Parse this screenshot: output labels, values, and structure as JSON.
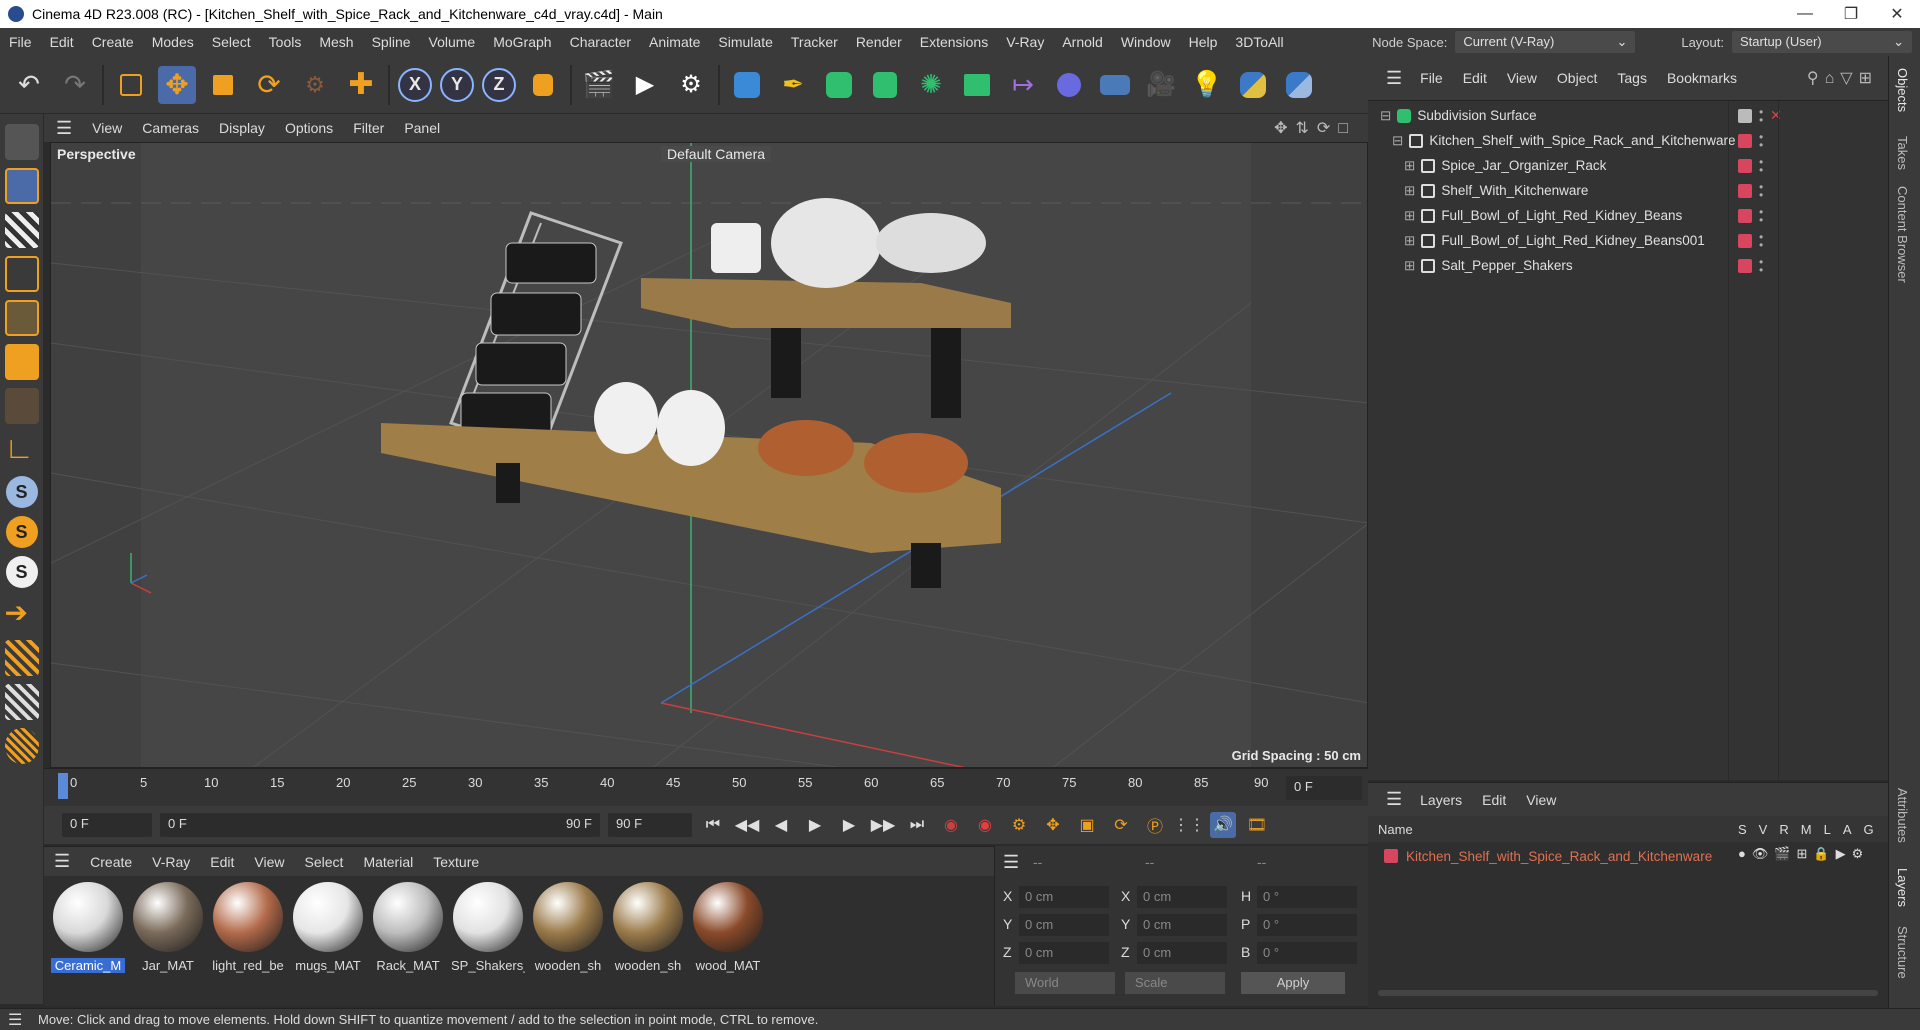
{
  "window": {
    "title": "Cinema 4D R23.008 (RC) - [Kitchen_Shelf_with_Spice_Rack_and_Kitchenware_c4d_vray.c4d] - Main"
  },
  "menubar": {
    "items": [
      "File",
      "Edit",
      "Create",
      "Modes",
      "Select",
      "Tools",
      "Mesh",
      "Spline",
      "Volume",
      "MoGraph",
      "Character",
      "Animate",
      "Simulate",
      "Tracker",
      "Render",
      "Extensions",
      "V-Ray",
      "Arnold",
      "Window",
      "Help",
      "3DToAll"
    ],
    "node_space_label": "Node Space:",
    "node_space_value": "Current (V-Ray)",
    "layout_label": "Layout:",
    "layout_value": "Startup (User)"
  },
  "toolbar": {
    "axis_x": "X",
    "axis_y": "Y",
    "axis_z": "Z"
  },
  "viewport": {
    "menu": [
      "View",
      "Cameras",
      "Display",
      "Options",
      "Filter",
      "Panel"
    ],
    "view_name": "Perspective",
    "camera": "Default Camera",
    "grid_spacing": "Grid Spacing : 50 cm"
  },
  "timeline": {
    "ticks": [
      "0",
      "5",
      "10",
      "15",
      "20",
      "25",
      "30",
      "35",
      "40",
      "45",
      "50",
      "55",
      "60",
      "65",
      "70",
      "75",
      "80",
      "85",
      "90"
    ],
    "current_frame": "0 F",
    "start_field": "0 F",
    "range_start": "0 F",
    "range_end": "90 F",
    "end_field": "90 F"
  },
  "materials": {
    "menu": [
      "Create",
      "V-Ray",
      "Edit",
      "View",
      "Select",
      "Material",
      "Texture"
    ],
    "items": [
      {
        "name": "Ceramic_M",
        "color": "#d9d9d9"
      },
      {
        "name": "Jar_MAT",
        "color": "#7a6a5a"
      },
      {
        "name": "light_red_be",
        "color": "#b36a4a"
      },
      {
        "name": "mugs_MAT",
        "color": "#e6e6e6"
      },
      {
        "name": "Rack_MAT",
        "color": "#bdbdbd"
      },
      {
        "name": "SP_Shakers_",
        "color": "#e2e2e2"
      },
      {
        "name": "wooden_sh",
        "color": "#9a7a4a"
      },
      {
        "name": "wooden_sh",
        "color": "#9c7c4c"
      },
      {
        "name": "wood_MAT",
        "color": "#8a4a2a"
      }
    ]
  },
  "coords": {
    "header": [
      "--",
      "--",
      "--"
    ],
    "rows": [
      {
        "a": "X",
        "v1": "0 cm",
        "b": "X",
        "v2": "0 cm",
        "c": "H",
        "v3": "0 °"
      },
      {
        "a": "Y",
        "v1": "0 cm",
        "b": "Y",
        "v2": "0 cm",
        "c": "P",
        "v3": "0 °"
      },
      {
        "a": "Z",
        "v1": "0 cm",
        "b": "Z",
        "v2": "0 cm",
        "c": "B",
        "v3": "0 °"
      }
    ],
    "world": "World",
    "scale": "Scale",
    "apply": "Apply"
  },
  "objects": {
    "menu": [
      "File",
      "Edit",
      "View",
      "Object",
      "Tags",
      "Bookmarks"
    ],
    "tree": [
      {
        "name": "Subdivision Surface",
        "indent": 0
      },
      {
        "name": "Kitchen_Shelf_with_Spice_Rack_and_Kitchenware",
        "indent": 1
      },
      {
        "name": "Spice_Jar_Organizer_Rack",
        "indent": 2
      },
      {
        "name": "Shelf_With_Kitchenware",
        "indent": 2
      },
      {
        "name": "Full_Bowl_of_Light_Red_Kidney_Beans",
        "indent": 2
      },
      {
        "name": "Full_Bowl_of_Light_Red_Kidney_Beans001",
        "indent": 2
      },
      {
        "name": "Salt_Pepper_Shakers",
        "indent": 2
      }
    ]
  },
  "layers": {
    "menu": [
      "Layers",
      "Edit",
      "View"
    ],
    "header_name": "Name",
    "header_flags": [
      "S",
      "V",
      "R",
      "M",
      "L",
      "A",
      "G"
    ],
    "row": "Kitchen_Shelf_with_Spice_Rack_and_Kitchenware"
  },
  "sidetabs": [
    "Objects",
    "Takes",
    "Content Browser",
    "Attributes",
    "Layers",
    "Structure"
  ],
  "status": "Move: Click and drag to move elements. Hold down SHIFT to quantize movement / add to the selection in point mode, CTRL to remove."
}
